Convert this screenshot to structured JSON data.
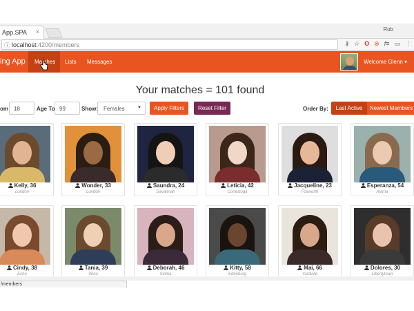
{
  "browser": {
    "tab_title": "App.SPA",
    "tab_close": "×",
    "window_controls": "Rob",
    "url_host": "localhost",
    "url_path": ":4200/members",
    "icons": [
      "key-icon",
      "star-icon",
      "opera-icon",
      "adblock-icon",
      "f-icon",
      "cast-icon",
      "menu-icon"
    ]
  },
  "navbar": {
    "brand": "ing App",
    "items": [
      {
        "label": "Matches",
        "active": true
      },
      {
        "label": "Lists",
        "active": false
      },
      {
        "label": "Messages",
        "active": false
      }
    ],
    "welcome": "Welcome Glenn ▾"
  },
  "page": {
    "heading": "Your matches = 101 found"
  },
  "filters": {
    "age_from_label": "om",
    "age_from_value": "18",
    "age_to_label": "Age To",
    "age_to_value": "99",
    "show_label": "Show:",
    "show_value": "Females",
    "apply_label": "Apply Filters",
    "reset_label": "Reset Filter",
    "order_label": "Order By:",
    "order_last_active": "Last Active",
    "order_newest": "Newest Members"
  },
  "members": [
    {
      "name": "Kelly, 36",
      "city": "London",
      "bg": "#5a6b7a",
      "hair": "#6b4a2e",
      "skin": "#e2b592",
      "cloth": "#d9b86a"
    },
    {
      "name": "Wonder, 33",
      "city": "London",
      "bg": "#e0913a",
      "hair": "#2b1d12",
      "skin": "#9a6a45",
      "cloth": "#3a2b2b"
    },
    {
      "name": "Saundra, 24",
      "city": "Savannah",
      "bg": "#1f2440",
      "hair": "#141414",
      "skin": "#f0cdb5",
      "cloth": "#2b2b2b"
    },
    {
      "name": "Leticia, 42",
      "city": "Conestoga",
      "bg": "#b99a8e",
      "hair": "#3b2619",
      "skin": "#f1d7c8",
      "cloth": "#7a2d2d"
    },
    {
      "name": "Jacqueline, 23",
      "city": "Foxworth",
      "bg": "#dedede",
      "hair": "#2b1a12",
      "skin": "#e7b898",
      "cloth": "#1c2235"
    },
    {
      "name": "Esperanza, 54",
      "city": "Alama",
      "bg": "#9bb1ad",
      "hair": "#8a6a4e",
      "skin": "#ecc9b1",
      "cloth": "#2a5a7a"
    },
    {
      "name": "Cindy, 38",
      "city": "Echo",
      "bg": "#c6b8a8",
      "hair": "#7a4a2e",
      "skin": "#efc8ad",
      "cloth": "#d98a5a"
    },
    {
      "name": "Tania, 39",
      "city": "Vena",
      "bg": "#7a8a6a",
      "hair": "#6b4a2e",
      "skin": "#efd0b5",
      "cloth": "#2d3d5a"
    },
    {
      "name": "Deborah, 46",
      "city": "Selma",
      "bg": "#d7b4be",
      "hair": "#2b1d18",
      "skin": "#d9a88a",
      "cloth": "#3a2a3a"
    },
    {
      "name": "Kitty, 58",
      "city": "Edenburg",
      "bg": "#4a4a4a",
      "hair": "#1a1410",
      "skin": "#6a4530",
      "cloth": "#3a6a7a"
    },
    {
      "name": "Mai, 66",
      "city": "Yardville",
      "bg": "#e9e4dc",
      "hair": "#2b1d12",
      "skin": "#d7a88a",
      "cloth": "#3a2a2a"
    },
    {
      "name": "Dolores, 30",
      "city": "Libertytown",
      "bg": "#2e2e2e",
      "hair": "#5a3a28",
      "skin": "#e9c3ae",
      "cloth": "#3a3a3a"
    }
  ],
  "statusbar": {
    "url": "/members"
  }
}
